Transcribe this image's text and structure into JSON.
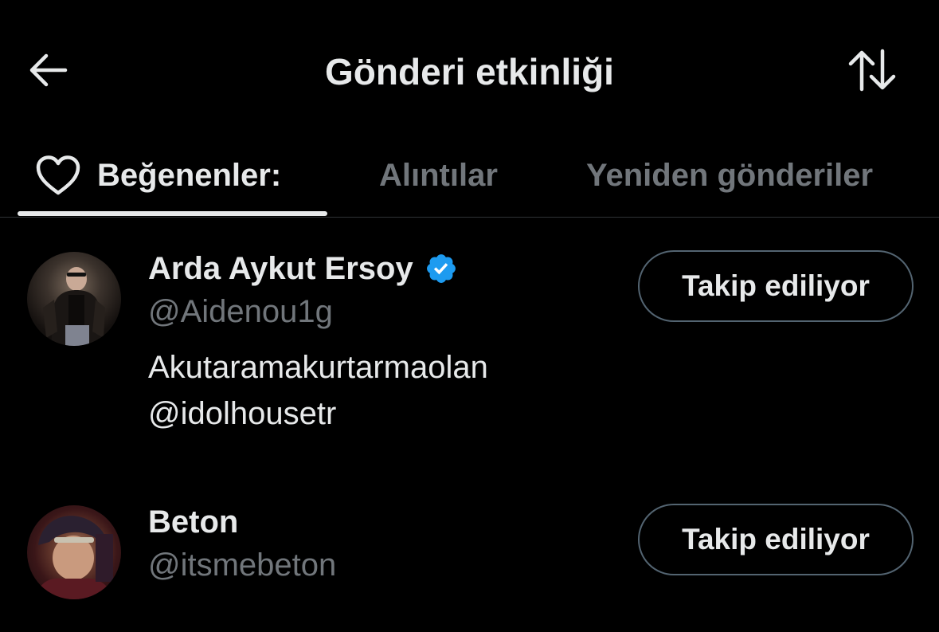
{
  "header": {
    "title": "Gönderi etkinliği",
    "back_icon": "arrow-left-icon",
    "sort_icon": "sort-arrows-icon"
  },
  "tabs": [
    {
      "label": "Beğenenler:",
      "icon": "heart-icon",
      "active": true
    },
    {
      "label": "Alıntılar",
      "active": false
    },
    {
      "label": "Yeniden gönderiler",
      "active": false
    }
  ],
  "users": [
    {
      "name": "Arda Aykut Ersoy",
      "verified": true,
      "handle": "@Aidenou1g",
      "bio_line1": "Akutaramakurtarmaolan",
      "bio_line2": "@idolhousetr",
      "follow_label": "Takip ediliyor"
    },
    {
      "name": "Beton",
      "verified": false,
      "handle": "@itsmebeton",
      "follow_label": "Takip ediliyor"
    }
  ],
  "colors": {
    "background": "#000000",
    "primary_text": "#e7e9ea",
    "secondary_text": "#71767b",
    "verified_blue": "#1d9bf0",
    "button_border": "#536471",
    "divider": "#2f3336"
  }
}
